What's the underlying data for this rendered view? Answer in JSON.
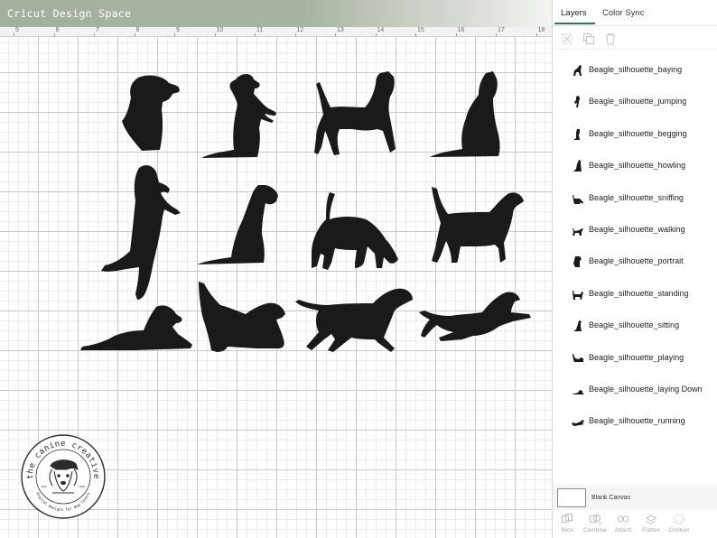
{
  "header": {
    "title": "Cricut Design Space"
  },
  "ruler": {
    "ticks": [
      "5",
      "6",
      "7",
      "8",
      "9",
      "10",
      "11",
      "12",
      "13",
      "14",
      "15",
      "16",
      "17",
      "18"
    ]
  },
  "panel": {
    "tabs": [
      {
        "label": "Layers",
        "active": true
      },
      {
        "label": "Color Sync",
        "active": false
      }
    ],
    "actions": [
      "group-icon",
      "duplicate-icon",
      "delete-icon"
    ],
    "layers": [
      {
        "name": "Beagle_silhouette_baying",
        "icon": "howl-dog-icon"
      },
      {
        "name": "Beagle_silhouette_jumping",
        "icon": "standing-up-dog-icon"
      },
      {
        "name": "Beagle_silhouette_begging",
        "icon": "begging-dog-icon"
      },
      {
        "name": "Beagle_silhouette_howling",
        "icon": "howling-dog-icon"
      },
      {
        "name": "Beagle_silhouette_sniffing",
        "icon": "sniffing-dog-icon"
      },
      {
        "name": "Beagle_silhouette_walking",
        "icon": "walking-dog-icon"
      },
      {
        "name": "Beagle_silhouette_portrait",
        "icon": "portrait-dog-icon"
      },
      {
        "name": "Beagle_silhouette_standing",
        "icon": "standing-dog-icon"
      },
      {
        "name": "Beagle_silhouette_sitting",
        "icon": "sitting-dog-icon"
      },
      {
        "name": "Beagle_silhouette_playing",
        "icon": "playing-dog-icon"
      },
      {
        "name": "Beagle_silhouette_laying Down",
        "icon": "laying-dog-icon"
      },
      {
        "name": "Beagle_silhouette_running",
        "icon": "running-dog-icon"
      }
    ],
    "blank_canvas": {
      "label": "Blank Canvas"
    },
    "tools": [
      {
        "label": "Slice",
        "icon": "slice-icon"
      },
      {
        "label": "Combine",
        "icon": "combine-icon"
      },
      {
        "label": "Attach",
        "icon": "attach-icon"
      },
      {
        "label": "Flatten",
        "icon": "flatten-icon"
      },
      {
        "label": "Contour",
        "icon": "contour-icon"
      }
    ]
  },
  "logo": {
    "text_top": "the canine creative",
    "text_bottom": "digital designs for dog lovers",
    "est": "EST.",
    "year": "2021"
  },
  "colors": {
    "accent": "#2f7a44",
    "header": "#a8b4a2",
    "silhouette": "#1a1a1a"
  }
}
